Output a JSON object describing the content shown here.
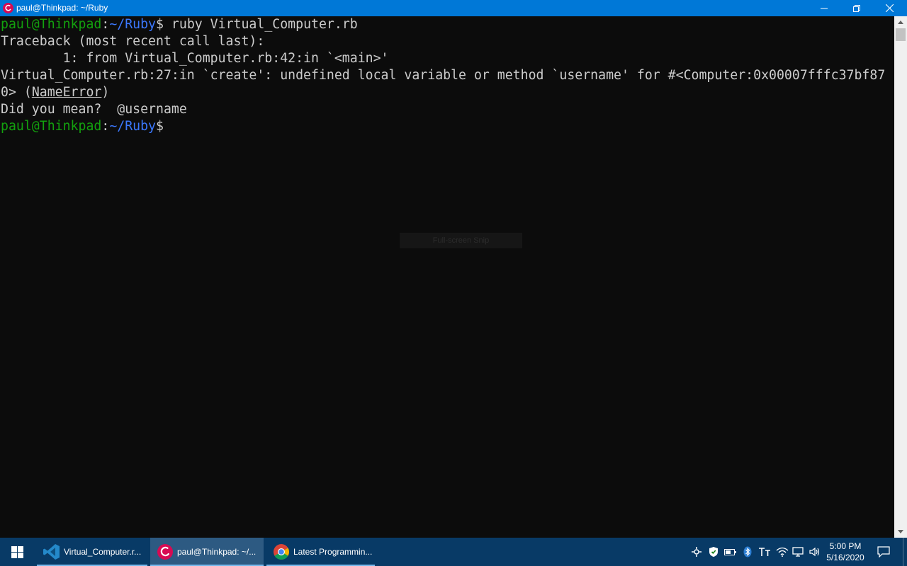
{
  "window": {
    "title": "paul@Thinkpad: ~/Ruby"
  },
  "terminal": {
    "lines": [
      {
        "user_host": "paul@Thinkpad",
        "path": "~/Ruby",
        "prompt_char": "$",
        "command": " ruby Virtual_Computer.rb"
      },
      {
        "text": "Traceback (most recent call last):"
      },
      {
        "text": "        1: from Virtual_Computer.rb:42:in `<main>'"
      },
      {
        "text": "Virtual_Computer.rb:27:in `create': undefined local variable or method `username' for #<Computer:0x00007fffc37bf87"
      },
      {
        "text_pre": "0> (",
        "error_class": "NameError",
        "text_post": ")"
      },
      {
        "text": "Did you mean?  @username"
      },
      {
        "user_host": "paul@Thinkpad",
        "path": "~/Ruby",
        "prompt_char": "$",
        "command": ""
      }
    ]
  },
  "overlay": {
    "snip_label": "Full-screen Snip"
  },
  "taskbar": {
    "apps": [
      {
        "label": "Virtual_Computer.r...",
        "icon": "vscode-icon"
      },
      {
        "label": "paul@Thinkpad: ~/...",
        "icon": "debian-icon"
      },
      {
        "label": "Latest Programmin...",
        "icon": "chrome-icon"
      }
    ],
    "clock": {
      "time": "5:00 PM",
      "date": "5/16/2020"
    }
  },
  "colors": {
    "titlebar": "#0078d7",
    "terminal_bg": "#0c0c0c",
    "terminal_fg": "#cccccc",
    "prompt_user": "#13a10e",
    "prompt_path": "#3b78ff",
    "taskbar": "#083a66"
  }
}
